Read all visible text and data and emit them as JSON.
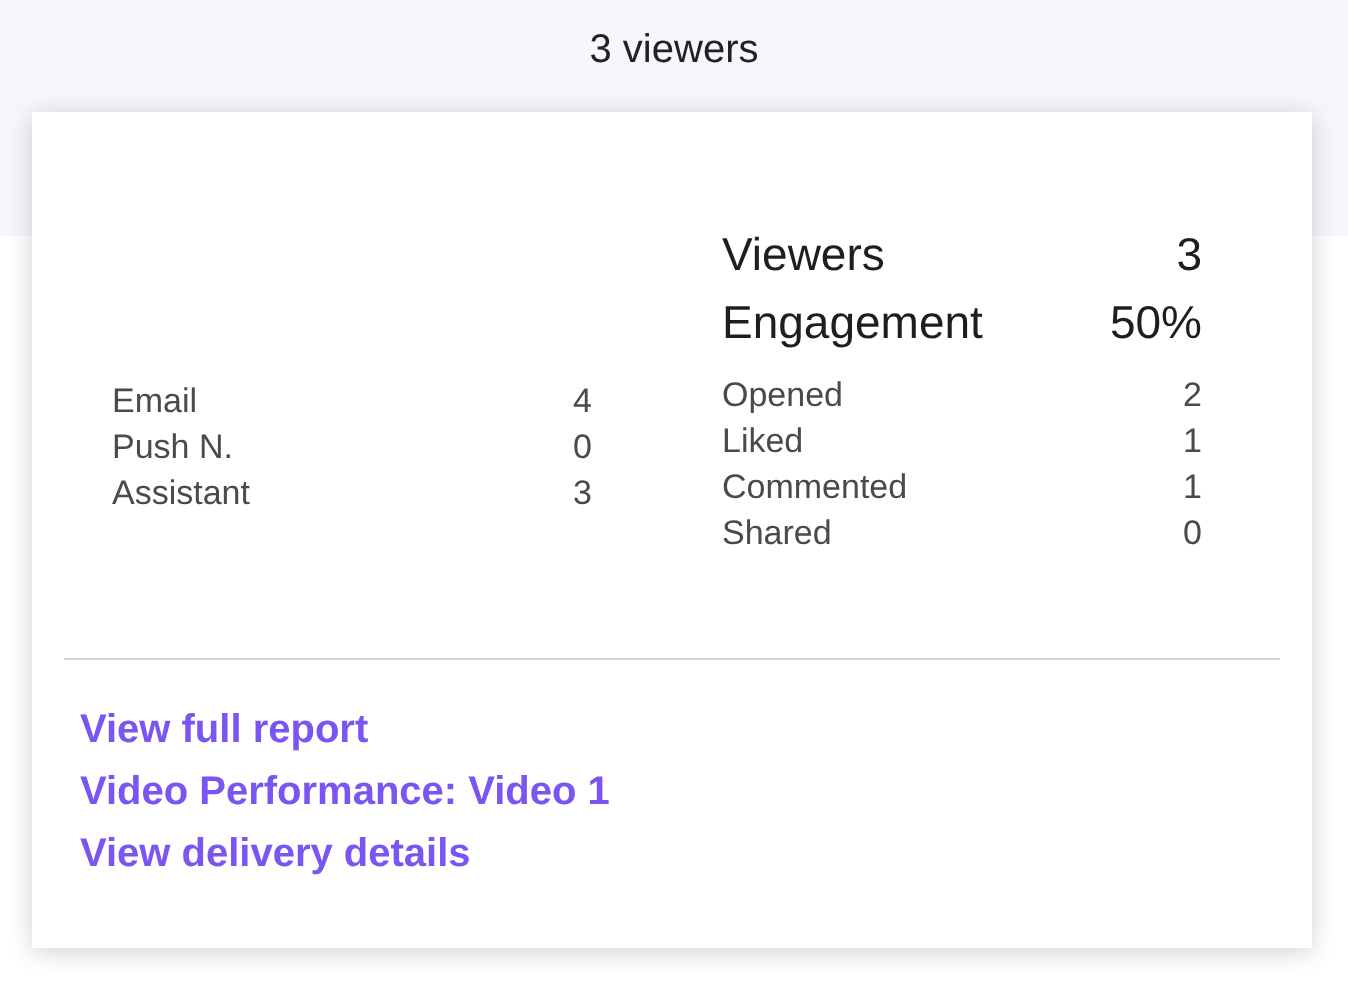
{
  "background": {
    "viewers": "3 viewers"
  },
  "popup": {
    "summary": [
      {
        "label": "Viewers",
        "value": "3"
      },
      {
        "label": "Engagement",
        "value": "50%"
      }
    ],
    "channels": [
      {
        "label": "Email",
        "value": "4"
      },
      {
        "label": "Push N.",
        "value": "0"
      },
      {
        "label": "Assistant",
        "value": "3"
      }
    ],
    "actions": [
      {
        "label": "Opened",
        "value": "2"
      },
      {
        "label": "Liked",
        "value": "1"
      },
      {
        "label": "Commented",
        "value": "1"
      },
      {
        "label": "Shared",
        "value": "0"
      }
    ],
    "links": [
      "View full report",
      "Video Performance: Video 1",
      "View delivery details"
    ]
  }
}
